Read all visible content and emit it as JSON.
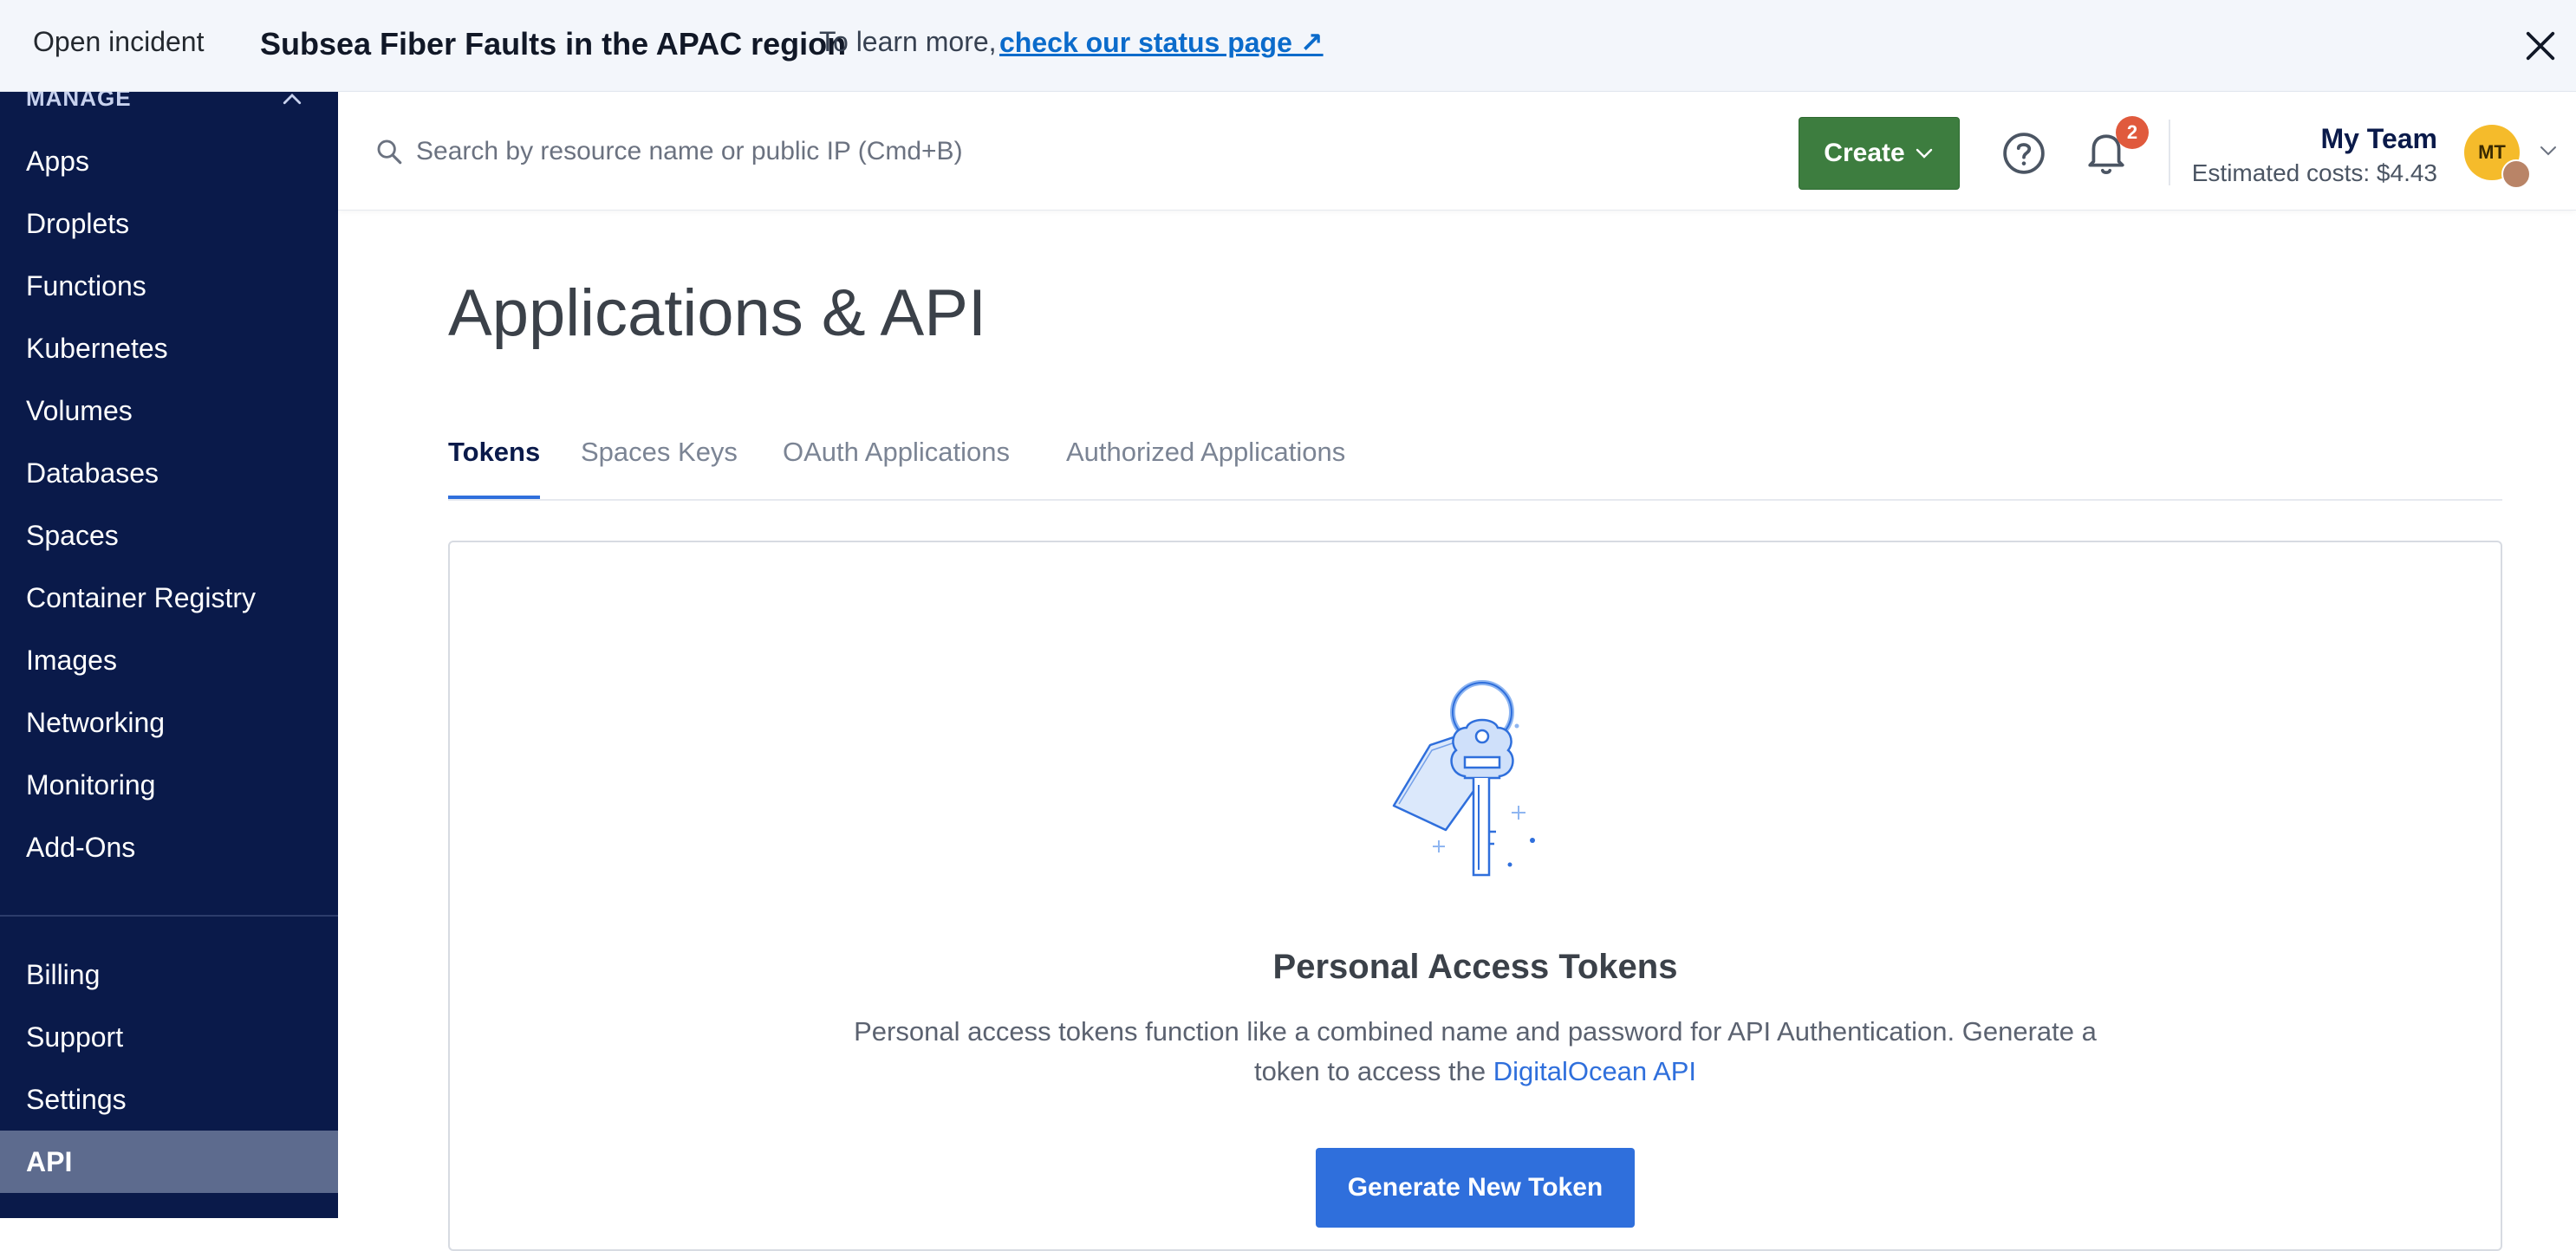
{
  "banner": {
    "status_label": "Open incident",
    "title": "Subsea Fiber Faults in the APAC region",
    "learn_text": "To learn more,",
    "link_text": "check our status page ↗"
  },
  "sidebar": {
    "section": "MANAGE",
    "items": [
      {
        "label": "Apps"
      },
      {
        "label": "Droplets"
      },
      {
        "label": "Functions"
      },
      {
        "label": "Kubernetes"
      },
      {
        "label": "Volumes"
      },
      {
        "label": "Databases"
      },
      {
        "label": "Spaces"
      },
      {
        "label": "Container Registry"
      },
      {
        "label": "Images"
      },
      {
        "label": "Networking"
      },
      {
        "label": "Monitoring"
      },
      {
        "label": "Add-Ons"
      }
    ],
    "account_items": [
      {
        "label": "Billing"
      },
      {
        "label": "Support"
      },
      {
        "label": "Settings"
      },
      {
        "label": "API"
      }
    ]
  },
  "header": {
    "search_placeholder": "Search by resource name or public IP (Cmd+B)",
    "create_label": "Create",
    "notification_count": "2",
    "team_name": "My Team",
    "estimated_costs": "Estimated costs: $4.43",
    "avatar_initials": "MT"
  },
  "page": {
    "title": "Applications & API",
    "tabs": [
      {
        "label": "Tokens"
      },
      {
        "label": "Spaces Keys"
      },
      {
        "label": "OAuth Applications"
      },
      {
        "label": "Authorized Applications"
      }
    ]
  },
  "card": {
    "title": "Personal Access Tokens",
    "description": "Personal access tokens function like a combined name and password for API Authentication. Generate a token to access the",
    "link_text": "DigitalOcean API",
    "button_label": "Generate New Token"
  },
  "colors": {
    "sidebar_bg": "#0a1a4a",
    "sidebar_active": "#5d6b8e",
    "create_green": "#3d7d3f",
    "primary_blue": "#2f6fdc",
    "badge_red": "#e05a3d",
    "avatar_yellow": "#f5bb2b"
  }
}
